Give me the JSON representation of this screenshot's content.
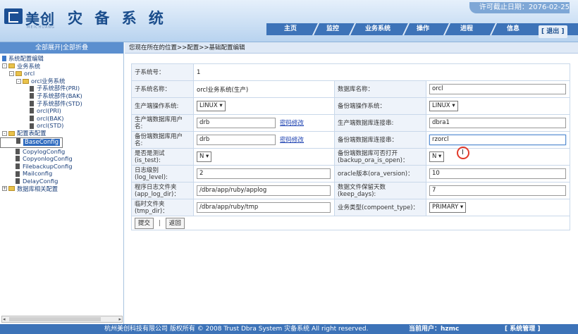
{
  "header": {
    "brand": "美创",
    "brand_sub": "MEICHUANG",
    "system_title": "灾 备 系 统",
    "license": "许可截止日期：2076-02-25",
    "nav": [
      "主页",
      "监控",
      "业务系统",
      "操作",
      "进程",
      "信息"
    ],
    "logout": "[ 退出 ]"
  },
  "sidebar": {
    "expand_all": "全部展开",
    "separator": "|",
    "collapse_all": "全部折叠",
    "tree": [
      {
        "label": "系统配置编辑",
        "depth": 0,
        "icon": "doc"
      },
      {
        "label": "业务系统",
        "depth": 0,
        "icon": "folder",
        "toggle": "-"
      },
      {
        "label": "orcl",
        "depth": 1,
        "icon": "folder",
        "toggle": "-"
      },
      {
        "label": "orcl业务系统",
        "depth": 2,
        "icon": "folder",
        "toggle": "-"
      },
      {
        "label": "子系统部件(PRI)",
        "depth": 3,
        "icon": "doc"
      },
      {
        "label": "子系统部件(BAK)",
        "depth": 3,
        "icon": "doc"
      },
      {
        "label": "子系统部件(STD)",
        "depth": 3,
        "icon": "doc"
      },
      {
        "label": "orcl(PRI)",
        "depth": 3,
        "icon": "doc"
      },
      {
        "label": "orcl(BAK)",
        "depth": 3,
        "icon": "doc"
      },
      {
        "label": "orcl(STD)",
        "depth": 3,
        "icon": "doc"
      },
      {
        "label": "配置表配置",
        "depth": 0,
        "icon": "folder",
        "toggle": "-"
      },
      {
        "label": "BaseConfig",
        "depth": 1,
        "icon": "doc",
        "selected": true
      },
      {
        "label": "CopylogConfig",
        "depth": 1,
        "icon": "doc"
      },
      {
        "label": "CopyonlogConfig",
        "depth": 1,
        "icon": "doc"
      },
      {
        "label": "FilebackupConfig",
        "depth": 1,
        "icon": "doc"
      },
      {
        "label": "Mailconfig",
        "depth": 1,
        "icon": "doc"
      },
      {
        "label": "DelayConfig",
        "depth": 1,
        "icon": "doc"
      },
      {
        "label": "数据库相关配置",
        "depth": 0,
        "icon": "folder",
        "toggle": "+"
      }
    ]
  },
  "breadcrumb": "您现在所在的位置>>配置>>基础配置编辑",
  "form": {
    "subsystem_no_label": "子系统号：",
    "subsystem_no_value": "1",
    "subsystem_name_label": "子系统名称：",
    "subsystem_name_value": "orcl业务系统(生产)",
    "db_name_label": "数据库名称：",
    "db_name_value": "orcl",
    "prod_os_label": "生产端操作系统:",
    "prod_os_value": "LINUX ▾",
    "bak_os_label": "备份端操作系统：",
    "bak_os_value": "LINUX ▾",
    "prod_db_user_label": "生产端数据库用户名:",
    "prod_db_user_value": "drb",
    "pwd_change": "密码修改",
    "prod_conn_label": "生产端数据库连接串:",
    "prod_conn_value": "dbra1",
    "bak_db_user_label": "备份端数据库用户名:",
    "bak_db_user_value": "drb",
    "bak_conn_label": "备份端数据库连接串：",
    "bak_conn_value": "rzorcl",
    "is_test_label": "是否是测试(is_test):",
    "is_test_value": "N ▾",
    "backup_open_label": "备份端数据库可否打开(backup_ora_is_open)：",
    "backup_open_value": "N ▾",
    "log_level_label": "日志级别(log_level):",
    "log_level_value": "2",
    "ora_version_label": "oracle版本(ora_version)：",
    "ora_version_value": "10",
    "app_log_dir_label": "程序日志文件夹(app_log_dir)：",
    "app_log_dir_value": "/dbra/app/ruby/applog",
    "keep_days_label": "数据文件保留天数(keep_days):",
    "keep_days_value": "7",
    "tmp_dir_label": "临时文件夹(tmp_dir)：",
    "tmp_dir_value": "/dbra/app/ruby/tmp",
    "compoent_type_label": "业务类型(compoent_type)：",
    "compoent_type_value": "PRIMARY ▾",
    "submit": "提交",
    "divider": "|",
    "back": "返回"
  },
  "footer": {
    "copyright": "杭州美创科技有限公司 版权所有 © 2008 Trust Dbra System 灾备系统 All right reserved.",
    "user": "当前用户：hzmc",
    "admin": "[ 系统管理 ]"
  }
}
